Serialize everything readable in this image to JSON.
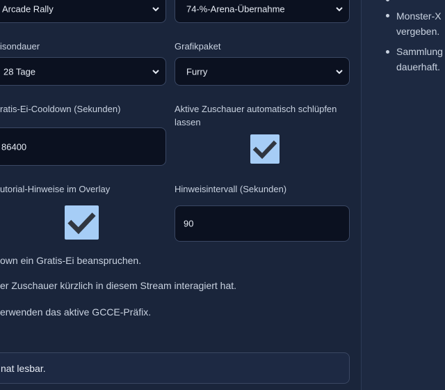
{
  "form": {
    "game_select": {
      "value": "Arcade Rally"
    },
    "arena_select": {
      "value": "74-%-Arena-Übernahme"
    },
    "season_label": "isondauer",
    "season_select": {
      "value": "28 Tage"
    },
    "graphics_label": "Grafikpaket",
    "graphics_select": {
      "value": "Furry"
    },
    "cooldown_label": "ratis-Ei-Cooldown (Sekunden)",
    "cooldown_input": {
      "value": "86400"
    },
    "auto_hatch_label": "Aktive Zuschauer automatisch schlüpfen lassen",
    "auto_hatch_checked": true,
    "tutorial_label": "utorial-Hinweise im Overlay",
    "tutorial_checked": true,
    "hint_interval_label": "Hinweisintervall (Sekunden)",
    "hint_interval_input": {
      "value": "90"
    }
  },
  "hints": [
    "own ein Gratis-Ei beanspruchen.",
    "er Zuschauer kürzlich in diesem Stream interagiert hat.",
    "erwenden das aktive GCCE-Präfix."
  ],
  "bottom_field": {
    "value": "nat lesbar."
  },
  "sidebar": {
    "items": [
      {
        "line1": "Monster-X",
        "line2": "vergeben."
      },
      {
        "line1": "Sammlung",
        "line2": "dauerhaft."
      }
    ]
  },
  "colors": {
    "background": "#1a253b",
    "field_bg": "#0b1120",
    "field_border": "#3a4763",
    "checkbox": "#a6cdf6",
    "checkmark": "#303640"
  },
  "icons": {
    "select_arrow": "chevron-down-icon",
    "checkbox_mark": "checkmark-icon"
  }
}
